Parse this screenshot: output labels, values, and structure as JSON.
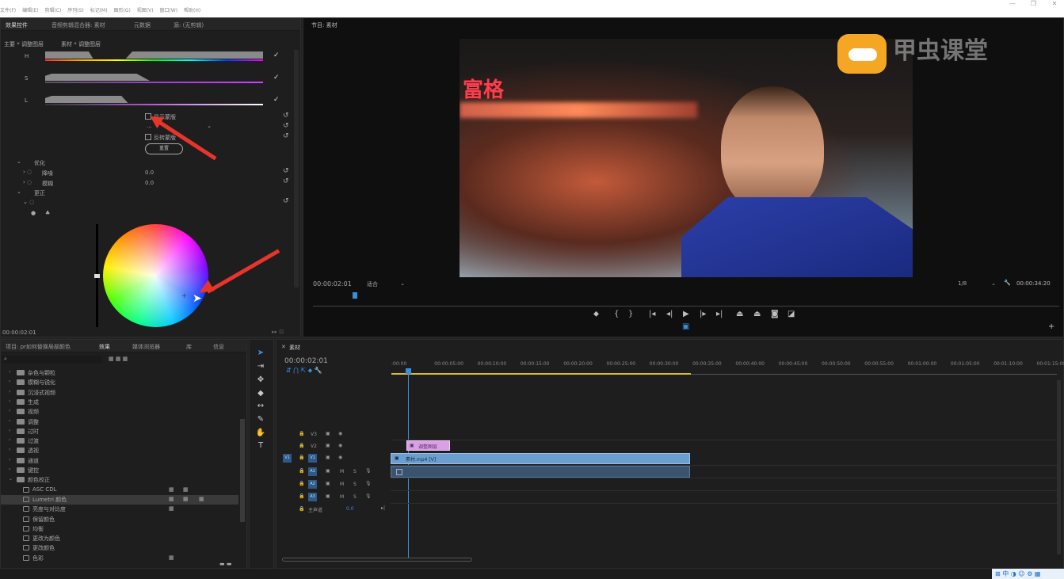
{
  "menubar": {
    "items": [
      "文件(F)",
      "编辑(E)",
      "剪辑(C)",
      "序列(S)",
      "标记(M)",
      "图形(G)",
      "视图(V)",
      "窗口(W)",
      "帮助(H)"
    ]
  },
  "window_controls": [
    "—",
    "❐",
    "✕"
  ],
  "effect_controls": {
    "tabs": [
      "效果控件",
      "音频剪辑混合器: 素材",
      "元数据",
      "源: (无剪辑)"
    ],
    "breadcrumb_master": "主要 * 调整图层",
    "breadcrumb_clip": "素材 * 调整图层",
    "hsl_labels": [
      "H",
      "S",
      "L"
    ],
    "show_mask": "显示蒙版",
    "dropdown_value": "...",
    "invert_mask": "反转蒙版",
    "reset_button": "重置",
    "optimize": "优化",
    "denoise": "降噪",
    "denoise_value": "0.0",
    "blur": "模糊",
    "blur_value": "0.0",
    "correction": "更正",
    "timecode": "00:00:02:01"
  },
  "program_monitor": {
    "title": "节目: 素材",
    "timecode": "00:00:02:01",
    "fit": "适合",
    "resolution": "1/8",
    "duration": "00:00:34:20",
    "watermark_text": "甲虫课堂",
    "sign_text": "富格"
  },
  "project_panel": {
    "tabs": [
      "项目: pr如何替换局部颜色",
      "效果",
      "媒体浏览器",
      "库",
      "信息"
    ],
    "folders": [
      "杂色与颗粒",
      "模糊与锐化",
      "沉浸式视频",
      "生成",
      "视频",
      "调整",
      "过时",
      "过渡",
      "透视",
      "通道",
      "键控"
    ],
    "color_folder": "颜色校正",
    "color_items": [
      "ASC CDL",
      "Lumetri 颜色",
      "亮度与对比度",
      "保留颜色",
      "均衡",
      "更改为颜色",
      "更改颜色",
      "色彩"
    ]
  },
  "timeline": {
    "tab": "素材",
    "timecode": "00:00:02:01",
    "ruler": [
      ":00:00",
      "00:00:05:00",
      "00:00:10:00",
      "00:00:15:00",
      "00:00:20:00",
      "00:00:25:00",
      "00:00:30:00",
      "00:00:35:00",
      "00:00:40:00",
      "00:00:45:00",
      "00:00:50:00",
      "00:00:55:00",
      "00:01:00:00",
      "00:01:05:00",
      "00:01:10:00",
      "00:01:15:00"
    ],
    "video_tracks": [
      "V3",
      "V2",
      "V1"
    ],
    "audio_tracks": [
      "A1",
      "A2",
      "A3"
    ],
    "source_patch": "V1",
    "master_label": "主声道",
    "master_value": "0.0",
    "adjustment_clip": "调整图层",
    "video_clip": "素材.mp4 [V]"
  },
  "colors": {
    "accent": "#3a8fdc",
    "clip_video": "#6a9fd0",
    "clip_adjust": "#d9a0e6",
    "arrow": "#e8352b"
  }
}
